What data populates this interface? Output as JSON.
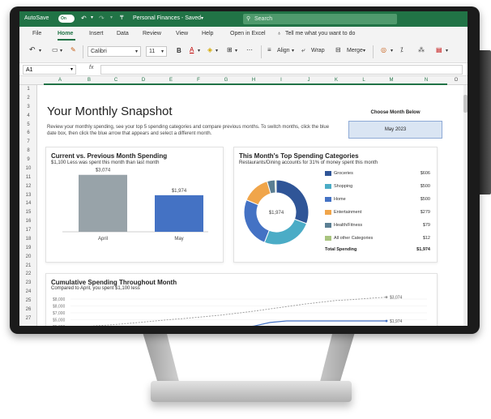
{
  "titlebar": {
    "autosave_label": "AutoSave",
    "autosave_state": "On",
    "document_title": "Personal Finances - Saved",
    "search_placeholder": "Search"
  },
  "menu": {
    "items": [
      "File",
      "Home",
      "Insert",
      "Data",
      "Review",
      "View",
      "Help",
      "Open in Excel"
    ],
    "active": "Home",
    "tell_me": "Tell me what you want to do"
  },
  "ribbon": {
    "font_name": "Calibri",
    "font_size": "11",
    "bold_label": "B",
    "align_label": "Align",
    "wrap_label": "Wrap",
    "merge_label": "Merge"
  },
  "formula_bar": {
    "name_box": "A1",
    "fx_label": "fx",
    "formula": ""
  },
  "grid": {
    "columns": [
      "A",
      "B",
      "C",
      "D",
      "E",
      "F",
      "G",
      "H",
      "I",
      "J",
      "K",
      "L",
      "M",
      "N",
      "O"
    ],
    "rows": [
      "1",
      "2",
      "3",
      "4",
      "5",
      "6",
      "7",
      "8",
      "9",
      "10",
      "11",
      "12",
      "13",
      "14",
      "15",
      "16",
      "17",
      "18",
      "19",
      "20",
      "21",
      "22",
      "23",
      "24",
      "25",
      "26",
      "27"
    ]
  },
  "dashboard": {
    "title": "Your Monthly Snapshot",
    "intro": "Review your monthly spending, see your top 5 spending categories and compare previous months. To switch months, click the blue date box, then click the blue arrow that appears and select a different month.",
    "choose_label": "Choose Month Below",
    "selected_month": "May 2023"
  },
  "comparison": {
    "title": "Current vs. Previous Month Spending",
    "subtitle": "$1,100 Less was spent this month than last month",
    "chart_data": {
      "type": "bar",
      "categories": [
        "April",
        "May"
      ],
      "values": [
        3074,
        1974
      ],
      "data_labels": [
        "$3,074",
        "$1,974"
      ],
      "colors": [
        "#98a3a9",
        "#4472c4"
      ]
    }
  },
  "top_categories": {
    "title": "This Month's Top Spending Categories",
    "subtitle": "Restaurants/Dining accounts for 31% of money spent this month",
    "center_label": "$1,974",
    "total_label": "Total Spending",
    "total_value": "$1,974",
    "chart_data": {
      "type": "pie",
      "categories": [
        "Groceries",
        "Shopping",
        "Home",
        "Entertainment",
        "Health/Fitness",
        "All other Categories"
      ],
      "values": [
        606,
        500,
        500,
        279,
        79,
        12
      ],
      "value_labels": [
        "$606",
        "$500",
        "$500",
        "$279",
        "$79",
        "$12"
      ],
      "colors": [
        "#2f5597",
        "#4bacc6",
        "#4472c4",
        "#f0a54a",
        "#5b7f93",
        "#a9c47f"
      ]
    }
  },
  "cumulative": {
    "title": "Cumulative Spending Throughout Month",
    "subtitle": "Compared to April, you spent $1,100 less",
    "chart_data": {
      "type": "line",
      "y_tick_labels": [
        "$8,000",
        "$8,000",
        "$7,000",
        "$5,000",
        "$5,000",
        "$4,000"
      ],
      "series": [
        {
          "label": "$3,074",
          "color": "#999999",
          "dashed": true,
          "values": [
            4000,
            4080,
            4150,
            4230,
            4320,
            4420,
            4520,
            4600,
            4700,
            4800,
            4920,
            5050,
            5200,
            5350,
            5500,
            5620,
            5740,
            5800,
            5880,
            5950
          ]
        },
        {
          "label": "$1,974",
          "color": "#4472c4",
          "dashed": false,
          "values": [
            null,
            null,
            null,
            null,
            null,
            null,
            null,
            null,
            null,
            3880,
            3960,
            4100,
            4330,
            4430,
            4430,
            4430,
            4430,
            4430,
            4430,
            4430
          ]
        }
      ]
    }
  }
}
